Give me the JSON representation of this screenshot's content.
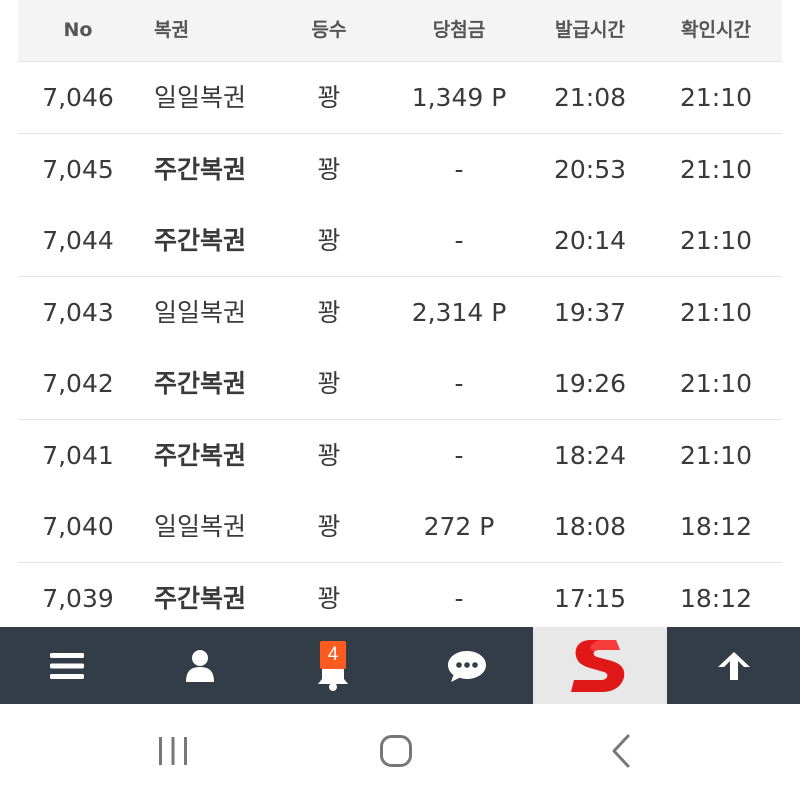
{
  "table": {
    "headers": {
      "no": "No",
      "type": "복권",
      "rank": "등수",
      "prize": "당첨금",
      "issued": "발급시간",
      "checked": "확인시간"
    },
    "rows": [
      {
        "no": "7,046",
        "type": "일일복권",
        "rank": "꽝",
        "prize": "1,349 P",
        "issued": "21:08",
        "checked": "21:10"
      },
      {
        "no": "7,045",
        "type": "주간복권",
        "rank": "꽝",
        "prize": "-",
        "issued": "20:53",
        "checked": "21:10"
      },
      {
        "no": "7,044",
        "type": "주간복권",
        "rank": "꽝",
        "prize": "-",
        "issued": "20:14",
        "checked": "21:10"
      },
      {
        "no": "7,043",
        "type": "일일복권",
        "rank": "꽝",
        "prize": "2,314 P",
        "issued": "19:37",
        "checked": "21:10"
      },
      {
        "no": "7,042",
        "type": "주간복권",
        "rank": "꽝",
        "prize": "-",
        "issued": "19:26",
        "checked": "21:10"
      },
      {
        "no": "7,041",
        "type": "주간복권",
        "rank": "꽝",
        "prize": "-",
        "issued": "18:24",
        "checked": "21:10"
      },
      {
        "no": "7,040",
        "type": "일일복권",
        "rank": "꽝",
        "prize": "272 P",
        "issued": "18:08",
        "checked": "18:12"
      },
      {
        "no": "7,039",
        "type": "주간복권",
        "rank": "꽝",
        "prize": "-",
        "issued": "17:15",
        "checked": "18:12"
      }
    ]
  },
  "bottom_bar": {
    "items": [
      {
        "icon": "menu-icon"
      },
      {
        "icon": "user-icon"
      },
      {
        "icon": "bell-icon",
        "badge": "4"
      },
      {
        "icon": "chat-icon"
      },
      {
        "icon": "site-logo"
      },
      {
        "icon": "arrow-up-icon"
      }
    ],
    "background": "#333d48",
    "badge_color": "#ff5a1f"
  },
  "system_nav": {
    "items": [
      {
        "icon": "recents-icon"
      },
      {
        "icon": "home-icon"
      },
      {
        "icon": "back-icon"
      }
    ]
  }
}
